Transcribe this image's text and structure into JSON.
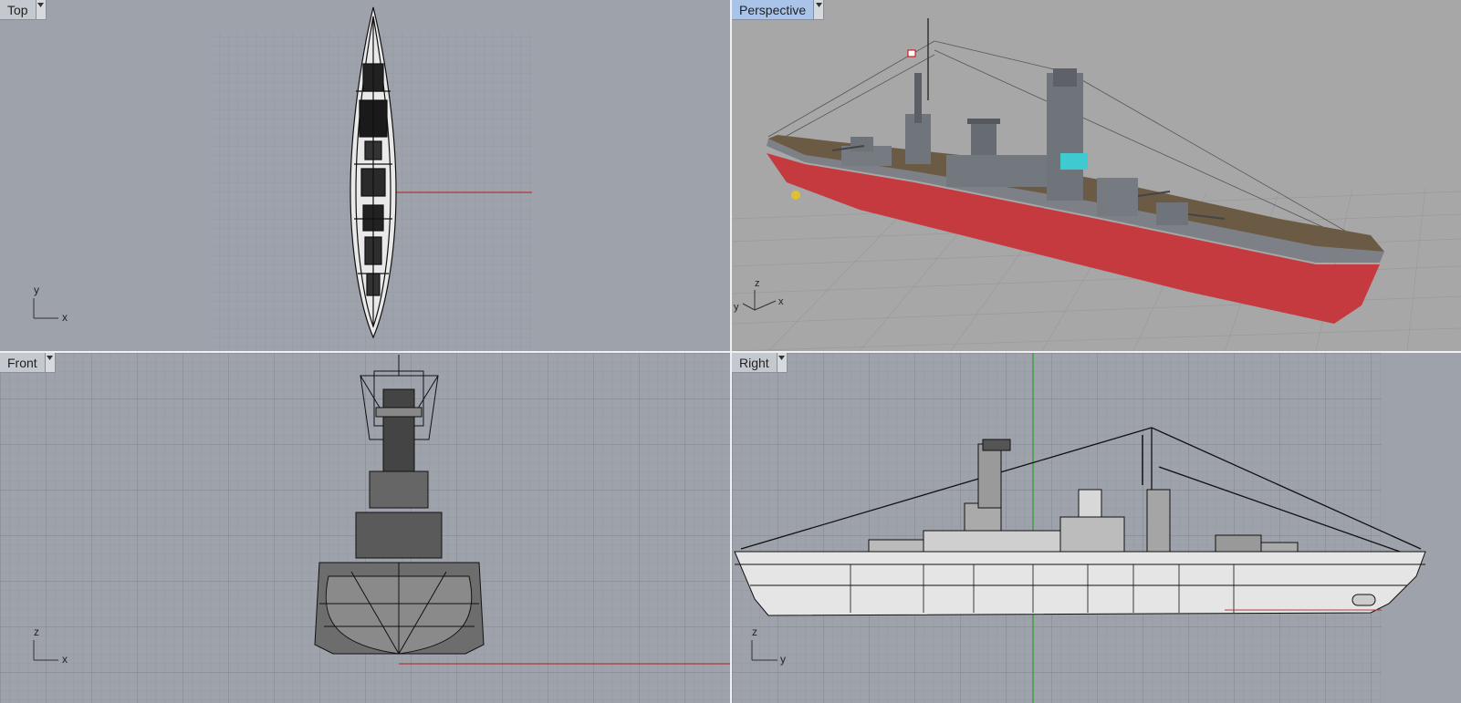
{
  "viewports": {
    "top": {
      "label": "Top",
      "axis_a": "y",
      "axis_b": "x"
    },
    "perspective": {
      "label": "Perspective",
      "axis_a": "z",
      "axis_b": "x",
      "axis_c": "y"
    },
    "front": {
      "label": "Front",
      "axis_a": "z",
      "axis_b": "x"
    },
    "right": {
      "label": "Right",
      "axis_a": "z",
      "axis_b": "y"
    }
  },
  "icons": {
    "dropdown": "chevron-down-icon",
    "axes": "axis-triad-icon"
  },
  "colors": {
    "grid_bg": "#9da2ab",
    "grid_line": "#8f949d",
    "grid_major": "#7f848d",
    "x_axis": "#b23a3a",
    "y_axis": "#2e9b2e",
    "active_tab": "#aac3e8",
    "hull_red": "#c53a3e",
    "hull_gray": "#7d8087",
    "deck_brown": "#6b5a44"
  }
}
